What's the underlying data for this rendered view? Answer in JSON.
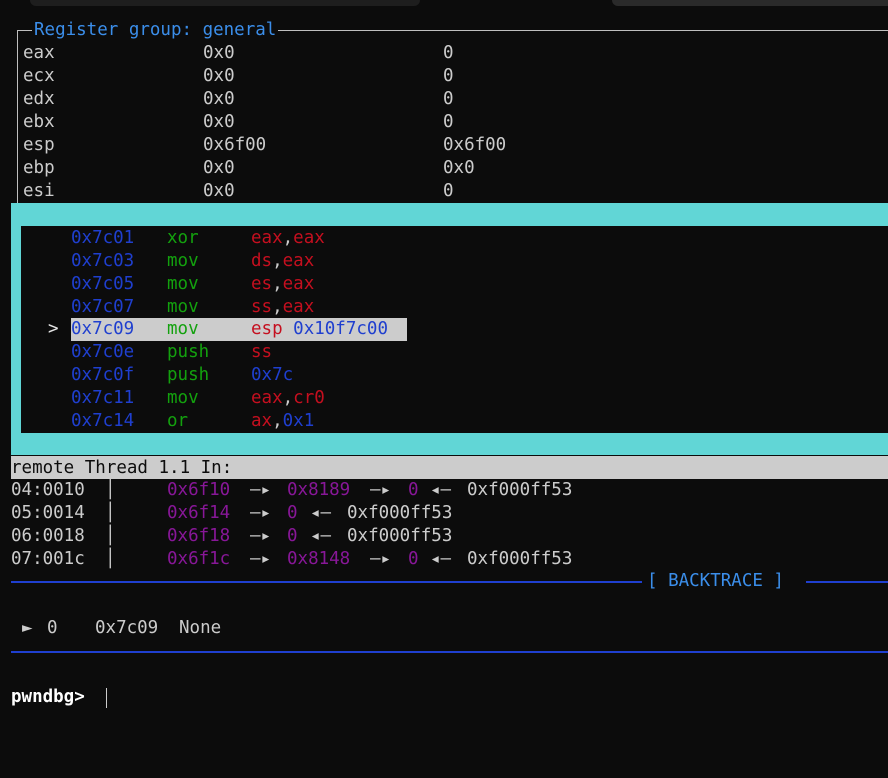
{
  "register_pane": {
    "title": "Register group: general",
    "rows": [
      {
        "name": "eax",
        "hex": "0x0",
        "natural": "0"
      },
      {
        "name": "ecx",
        "hex": "0x0",
        "natural": "0"
      },
      {
        "name": "edx",
        "hex": "0x0",
        "natural": "0"
      },
      {
        "name": "ebx",
        "hex": "0x0",
        "natural": "0"
      },
      {
        "name": "esp",
        "hex": "0x6f00",
        "natural": "0x6f00"
      },
      {
        "name": "ebp",
        "hex": "0x0",
        "natural": "0x0"
      },
      {
        "name": "esi",
        "hex": "0x0",
        "natural": "0"
      }
    ]
  },
  "disassembly": {
    "current_marker": ">",
    "rows": [
      {
        "addr": "0x7c01",
        "mnem": "xor",
        "op1": "eax",
        "comma": ",",
        "op2": "eax"
      },
      {
        "addr": "0x7c03",
        "mnem": "mov",
        "op1": "ds",
        "comma": ",",
        "op2": "eax"
      },
      {
        "addr": "0x7c05",
        "mnem": "mov",
        "op1": "es",
        "comma": ",",
        "op2": "eax"
      },
      {
        "addr": "0x7c07",
        "mnem": "mov",
        "op1": "ss",
        "comma": ",",
        "op2": "eax"
      },
      {
        "addr": "0x7c09",
        "mnem": "mov",
        "op1": "esp",
        "comma": ",",
        "op2": "0x10f7c00"
      },
      {
        "addr": "0x7c0e",
        "mnem": "push",
        "op1": "ss",
        "comma": "",
        "op2": ""
      },
      {
        "addr": "0x7c0f",
        "mnem": "push",
        "op1": "0x7c",
        "comma": "",
        "op2": ""
      },
      {
        "addr": "0x7c11",
        "mnem": "mov",
        "op1": "eax",
        "comma": ",",
        "op2": "cr0"
      },
      {
        "addr": "0x7c14",
        "mnem": "or",
        "op1": "ax",
        "comma": ",",
        "op2": "0x1"
      }
    ]
  },
  "status_line": "remote Thread 1.1 In:",
  "stack": {
    "separator": "│",
    "rows": [
      {
        "offset": "04:0010",
        "addr": "0x6f10",
        "arrow1": "—▸",
        "ptr": "0x8189",
        "arrow2": "—▸",
        "zero": "0",
        "arrow3": "◂—",
        "value": "0xf000ff53"
      },
      {
        "offset": "05:0014",
        "addr": "0x6f14",
        "arrow1": "—▸",
        "ptr": "0",
        "arrow2": "◂—",
        "value": "0xf000ff53"
      },
      {
        "offset": "06:0018",
        "addr": "0x6f18",
        "arrow1": "—▸",
        "ptr": "0",
        "arrow2": "◂—",
        "value": "0xf000ff53"
      },
      {
        "offset": "07:001c",
        "addr": "0x6f1c",
        "arrow1": "—▸",
        "ptr": "0x8148",
        "arrow2": "—▸",
        "zero": "0",
        "arrow3": "◂—",
        "value": "0xf000ff53"
      }
    ]
  },
  "backtrace": {
    "title": "[ BACKTRACE ]",
    "marker": "►",
    "frame": "0",
    "address": "0x7c09",
    "symbol": "None"
  },
  "prompt": "pwndbg>",
  "colors": {
    "pane_border": "#61d6d6",
    "address_blue": "#1f3fcf",
    "mnemonic_green": "#13a10e",
    "register_red": "#c50f1f",
    "stack_purple": "#881798",
    "title_blue": "#3b8eea"
  }
}
